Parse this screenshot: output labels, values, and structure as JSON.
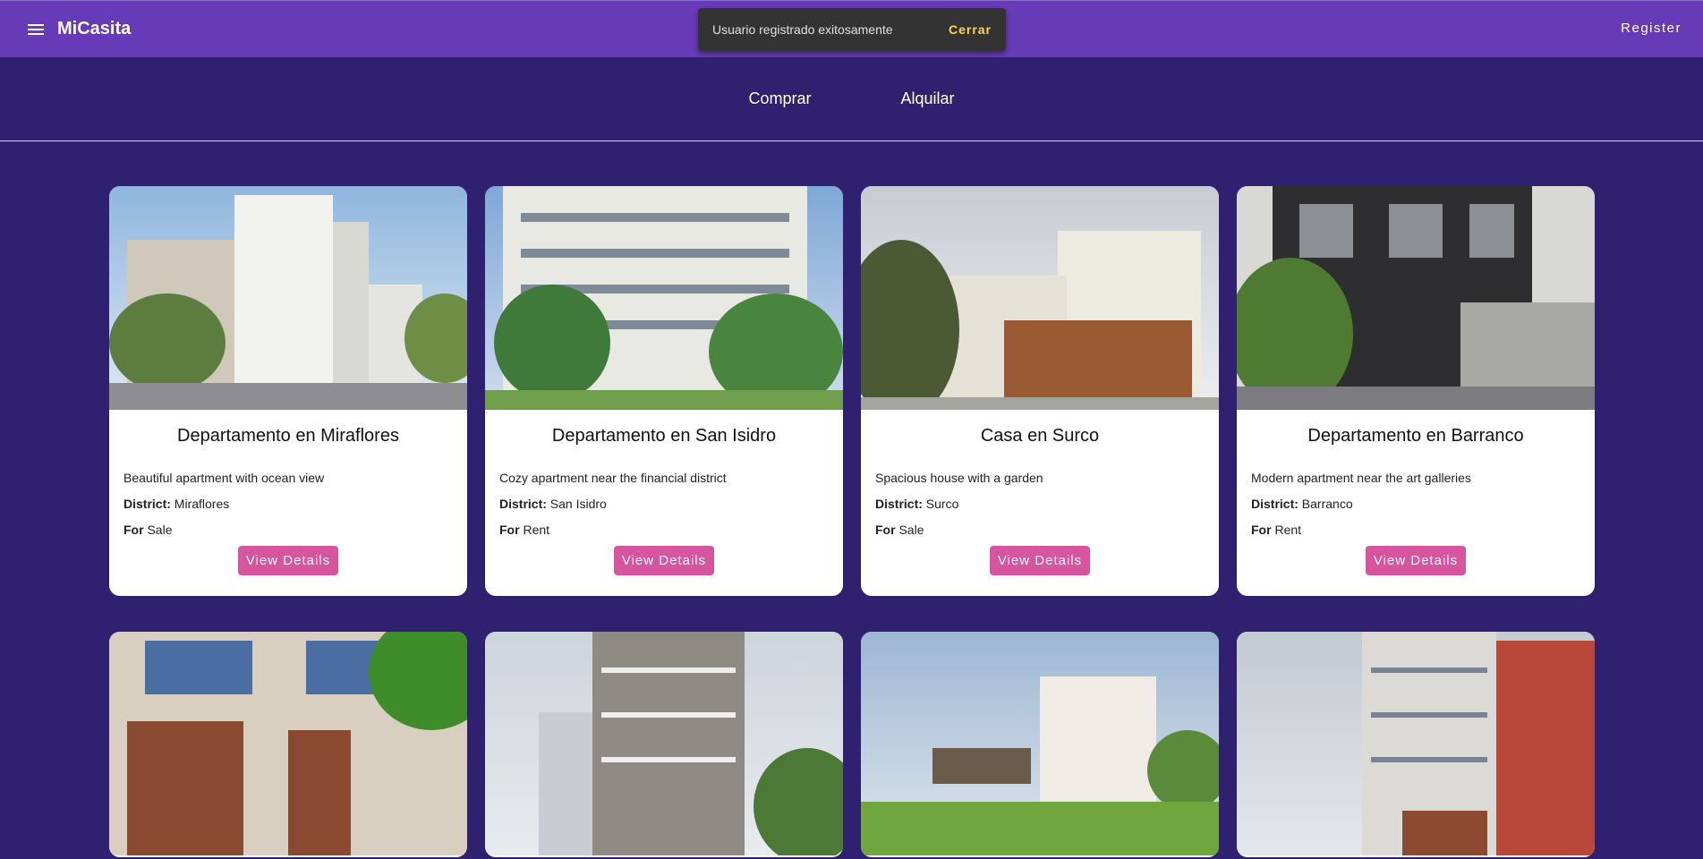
{
  "app": {
    "title": "MiCasita",
    "register_label": "Register"
  },
  "snackbar": {
    "message": "Usuario registrado exitosamente",
    "action": "Cerrar"
  },
  "tabs": [
    {
      "label": "Comprar"
    },
    {
      "label": "Alquilar"
    }
  ],
  "listings": [
    {
      "title": "Departamento en Miraflores",
      "description": "Beautiful apartment with ocean view",
      "district_label": "District:",
      "district": "Miraflores",
      "for_label": "For",
      "for": "Sale",
      "button": "View Details"
    },
    {
      "title": "Departamento en San Isidro",
      "description": "Cozy apartment near the financial district",
      "district_label": "District:",
      "district": "San Isidro",
      "for_label": "For",
      "for": "Rent",
      "button": "View Details"
    },
    {
      "title": "Casa en Surco",
      "description": "Spacious house with a garden",
      "district_label": "District:",
      "district": "Surco",
      "for_label": "For",
      "for": "Sale",
      "button": "View Details"
    },
    {
      "title": "Departamento en Barranco",
      "description": "Modern apartment near the art galleries",
      "district_label": "District:",
      "district": "Barranco",
      "for_label": "For",
      "for": "Rent",
      "button": "View Details"
    }
  ],
  "colors": {
    "toolbar": "#673ab7",
    "background": "#302070",
    "button": "#d6559e",
    "snackbar_action": "#ffd740"
  }
}
